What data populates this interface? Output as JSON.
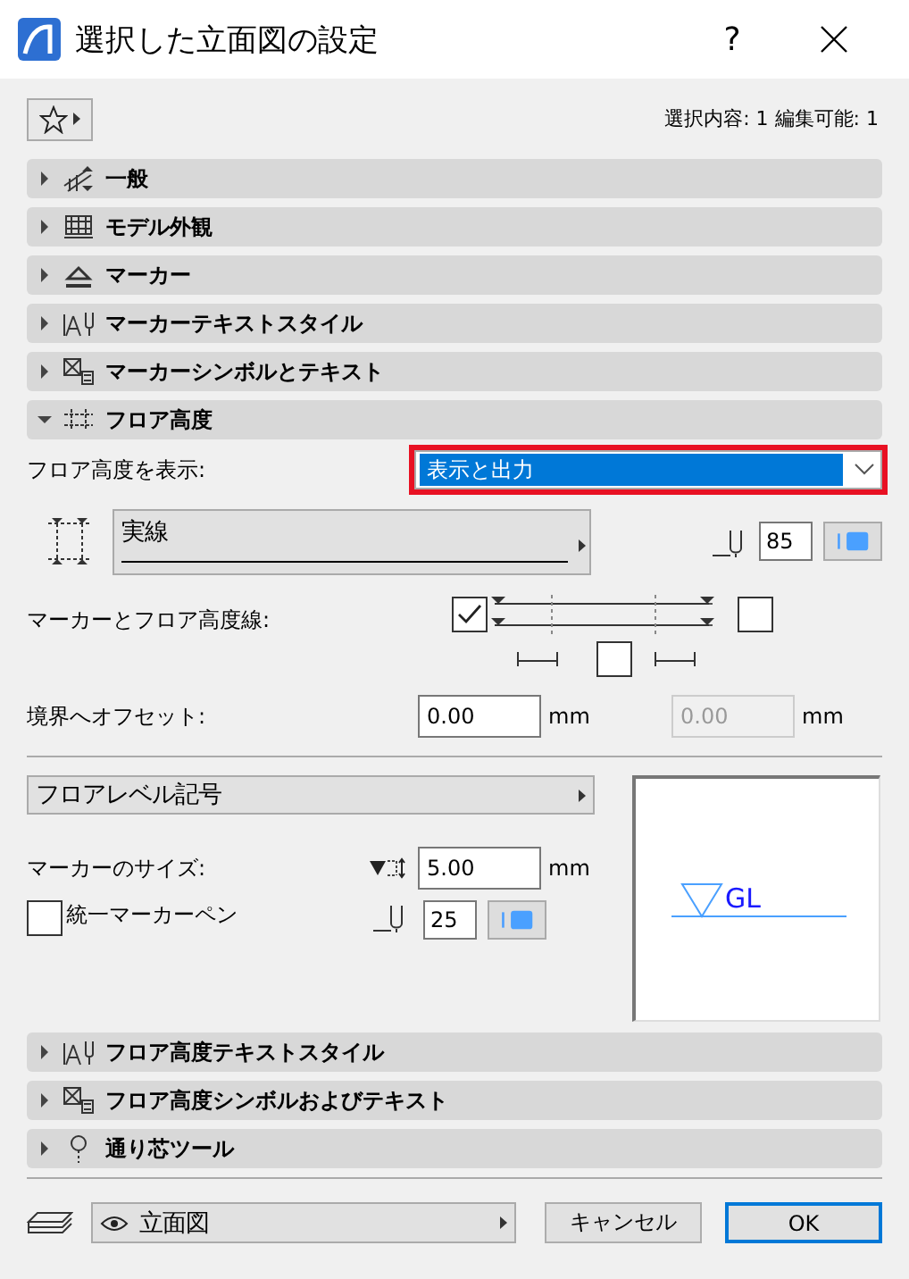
{
  "window": {
    "title": "選択した立面図の設定",
    "help": "?"
  },
  "toolbar": {
    "selection_info": "選択内容: 1 編集可能: 1"
  },
  "sections": [
    {
      "label": "一般",
      "expanded": false
    },
    {
      "label": "モデル外観",
      "expanded": false
    },
    {
      "label": "マーカー",
      "expanded": false
    },
    {
      "label": "マーカーテキストスタイル",
      "expanded": false
    },
    {
      "label": "マーカーシンボルとテキスト",
      "expanded": false
    },
    {
      "label": "フロア高度",
      "expanded": true
    },
    {
      "label": "フロア高度テキストスタイル",
      "expanded": false
    },
    {
      "label": "フロア高度シンボルおよびテキスト",
      "expanded": false
    },
    {
      "label": "通り芯ツール",
      "expanded": false
    }
  ],
  "floor_level": {
    "display": {
      "label": "フロア高度を表示:",
      "value": "表示と出力",
      "focused": true,
      "highlighted": true
    },
    "line_type": "実線",
    "line_pen": "85",
    "marker_lines": {
      "label": "マーカーとフロア高度線:",
      "checks": [
        {
          "checked": true
        },
        {
          "checked": false
        },
        {
          "checked": false
        }
      ]
    },
    "offset": {
      "label": "境界へオフセット:",
      "value": "0.00",
      "unit": "mm",
      "second_value": "0.00",
      "second_disabled": true,
      "second_unit": "mm"
    },
    "symbol": "フロアレベル記号",
    "marker_size": {
      "label": "マーカーのサイズ:",
      "value": "5.00",
      "unit": "mm"
    },
    "uniform_pen": {
      "label": "統一マーカーペン",
      "checked": false,
      "pen": "25"
    },
    "preview": {
      "text": "GL"
    }
  },
  "footer": {
    "layer": "立面図",
    "cancel": "キャンセル",
    "ok": "OK",
    "ok_default": true
  }
}
